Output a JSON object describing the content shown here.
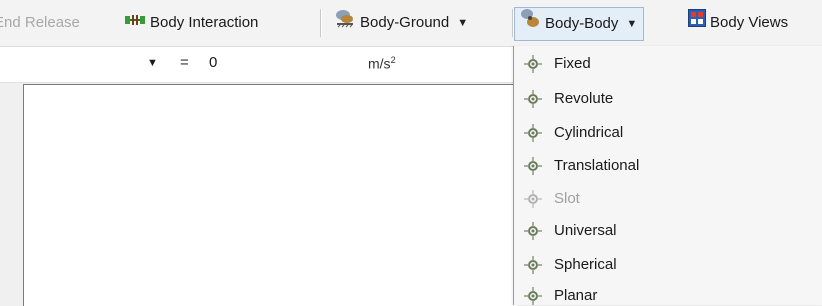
{
  "toolbar": {
    "end_release_label": "End Release",
    "body_interaction_label": "Body Interaction",
    "body_ground_label": "Body-Ground",
    "body_body_label": "Body-Body",
    "body_views_label": "Body Views"
  },
  "details_row": {
    "equals": "=",
    "value": "0",
    "unit": "m/s",
    "unit_power": "2"
  },
  "menu": {
    "items": [
      {
        "label": "Fixed",
        "enabled": true
      },
      {
        "label": "Revolute",
        "enabled": true
      },
      {
        "label": "Cylindrical",
        "enabled": true
      },
      {
        "label": "Translational",
        "enabled": true
      },
      {
        "label": "Slot",
        "enabled": false
      },
      {
        "label": "Universal",
        "enabled": true
      },
      {
        "label": "Spherical",
        "enabled": true,
        "highlighted": true
      },
      {
        "label": "Planar",
        "enabled": true
      }
    ]
  },
  "colors": {
    "highlight": "#ffff4d",
    "active_button_bg": "#e4eef9",
    "active_button_border": "#9fb8d6",
    "disabled_text": "#a0a0a0"
  },
  "icons": {
    "body_interaction": "body-interaction-icon",
    "body_ground": "body-ground-icon",
    "body_body": "body-body-icon",
    "body_views": "body-views-icon",
    "joint": "joint-icon"
  }
}
